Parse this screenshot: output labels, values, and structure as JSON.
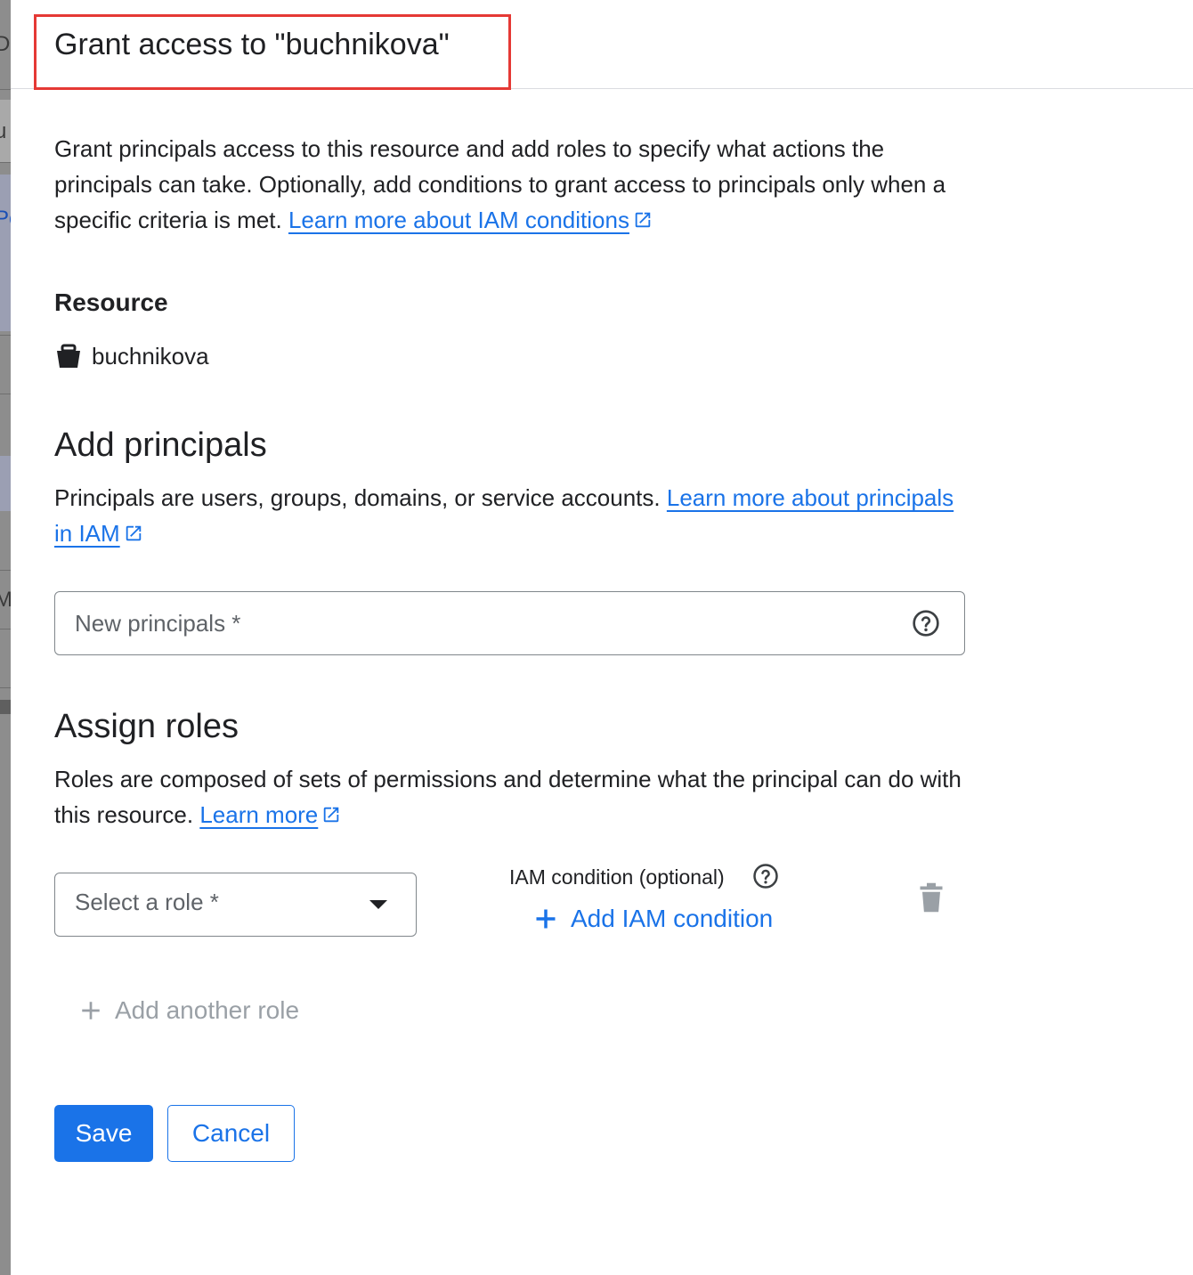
{
  "background_page": {
    "clipped_glyphs": [
      "D",
      "u",
      "Pe",
      "M"
    ]
  },
  "dialog": {
    "title": "Grant access to \"buchnikova\"",
    "intro": {
      "text": "Grant principals access to this resource and add roles to specify what actions the principals can take. Optionally, add conditions to grant access to principals only when a specific criteria is met.",
      "link": "Learn more about IAM conditions"
    },
    "resource": {
      "label": "Resource",
      "icon": "bucket-icon",
      "name": "buchnikova"
    },
    "add_principals": {
      "title": "Add principals",
      "description": "Principals are users, groups, domains, or service accounts.",
      "link": "Learn more about principals in IAM",
      "input": {
        "placeholder": "New principals *",
        "value": ""
      }
    },
    "assign_roles": {
      "title": "Assign roles",
      "description": "Roles are composed of sets of permissions and determine what the principal can do with this resource.",
      "link": "Learn more",
      "role_select": {
        "placeholder": "Select a role *"
      },
      "iam_condition_label": "IAM condition (optional)",
      "add_condition_label": "Add IAM condition",
      "add_another_role_label": "Add another role"
    },
    "actions": {
      "save": "Save",
      "cancel": "Cancel"
    }
  },
  "colors": {
    "accent": "#1a73e8",
    "highlight_border": "#e53935",
    "disabled": "#9aa0a6"
  }
}
